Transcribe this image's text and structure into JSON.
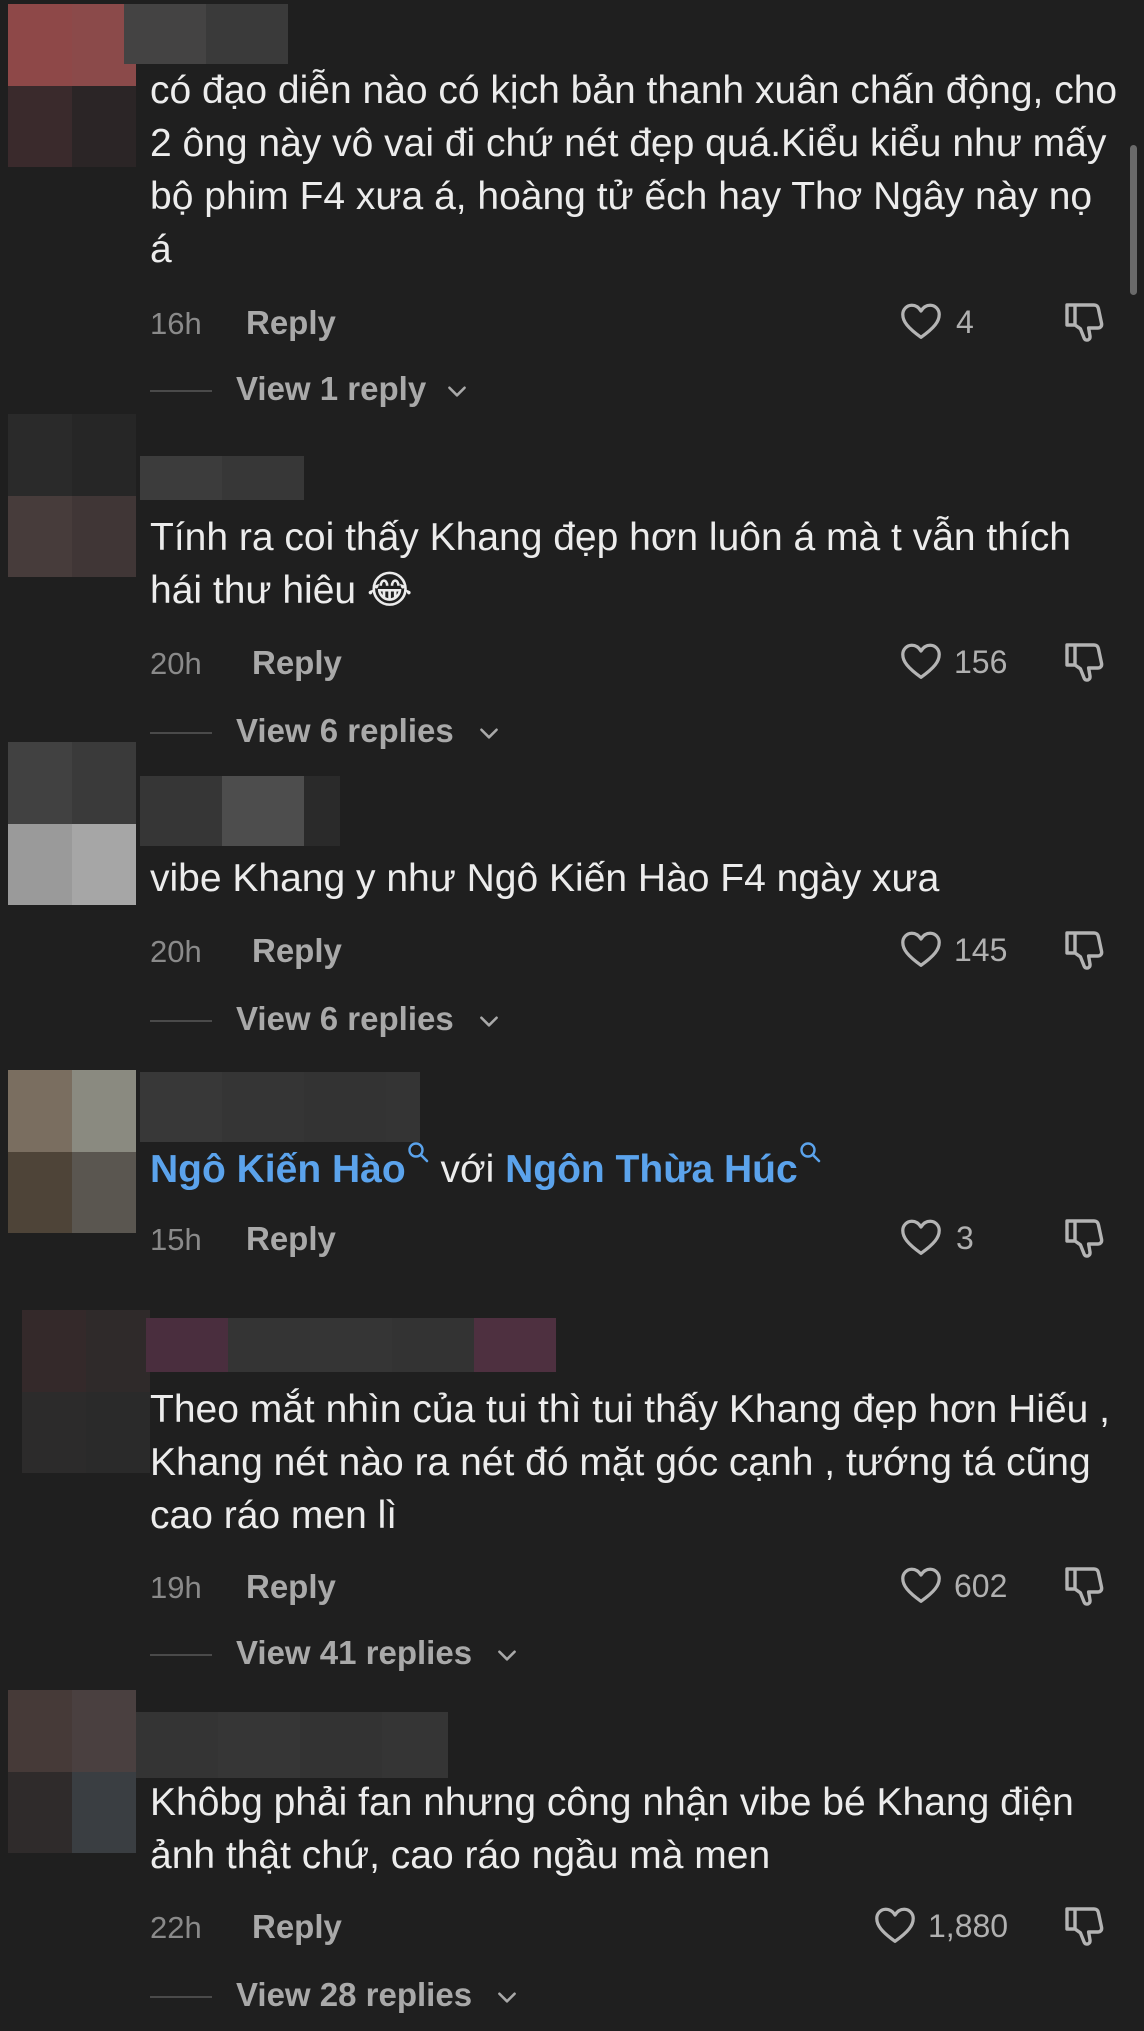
{
  "comments": [
    {
      "text": "có đạo diễn nào có kịch bản thanh xuân chấn động, cho 2 ông này vô vai đi chứ nét đẹp quá.Kiểu kiểu như mấy bộ phim F4 xưa á, hoàng tử ếch hay Thơ Ngây này nọ á",
      "time": "16h",
      "reply_label": "Reply",
      "likes": "4",
      "view_replies": "View 1 reply",
      "avatar_colors": [
        "#8e4848",
        "#8b4a4a",
        "#3a2a2c",
        "#2b2526"
      ],
      "name_colors": [
        "#444343",
        "#3a3a3a"
      ]
    },
    {
      "text": "Tính ra coi thấy Khang đẹp hơn luôn á mà t vẫn thích hái thư hiêu 😂",
      "time": "20h",
      "reply_label": "Reply",
      "likes": "156",
      "view_replies": "View 6 replies",
      "avatar_colors": [
        "#2a2a2a",
        "#262626",
        "#473c3b",
        "#403636"
      ],
      "name_colors": [
        "#3c3c3c",
        "#373737"
      ]
    },
    {
      "text": "vibe Khang y như Ngô Kiến Hào F4 ngày xưa",
      "time": "20h",
      "reply_label": "Reply",
      "likes": "145",
      "view_replies": "View 6 replies",
      "avatar_colors": [
        "#414141",
        "#3a3a3a",
        "#9a9a9a",
        "#a6a6a6"
      ],
      "name_colors": [
        "#363636",
        "#4d4d4d",
        "#2a2a2a"
      ]
    },
    {
      "mention1": "Ngô Kiến Hào",
      "connector": " với ",
      "mention2": "Ngôn Thừa Húc",
      "time": "15h",
      "reply_label": "Reply",
      "likes": "3",
      "avatar_colors": [
        "#7a6e60",
        "#8a8a80",
        "#4e4438",
        "#5a5650"
      ],
      "name_colors": [
        "#383838",
        "#353535",
        "#333333",
        "#343434"
      ]
    },
    {
      "text": "Theo mắt nhìn của tui thì tui thấy Khang đẹp hơn Hiếu , Khang nét nào ra nét đó mặt góc cạnh , tướng tá cũng cao ráo men lì",
      "time": "19h",
      "reply_label": "Reply",
      "likes": "602",
      "view_replies": "View 41 replies",
      "avatar_colors": [
        "#34292a",
        "#2f2a2a",
        "#2c2b2b",
        "#2a2a2a"
      ],
      "name_colors": [
        "#4a2e3e",
        "#343434",
        "#353535",
        "#333333",
        "#4e3040"
      ]
    },
    {
      "text": "Khôbg phải fan nhưng công nhận vibe bé Khang điện ảnh thật chứ, cao ráo ngầu mà men",
      "time": "22h",
      "reply_label": "Reply",
      "likes": "1,880",
      "view_replies": "View 28 replies",
      "avatar_colors": [
        "#463a38",
        "#4a4040",
        "#2f2b2b",
        "#3a3e42"
      ],
      "name_colors": [
        "#343434",
        "#363636",
        "#333333",
        "#353535"
      ]
    }
  ]
}
